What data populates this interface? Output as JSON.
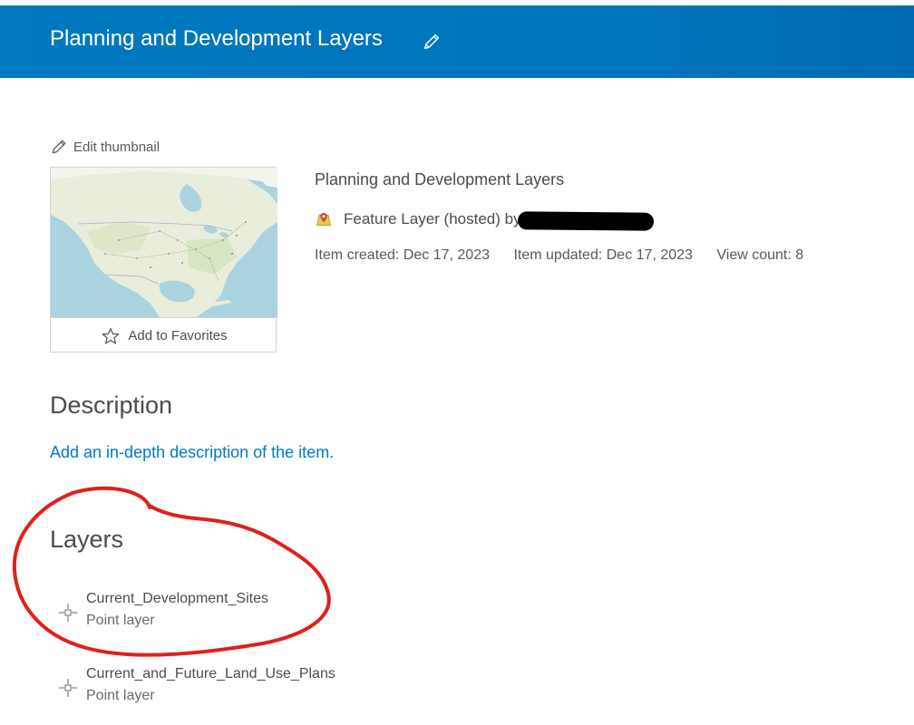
{
  "header": {
    "title": "Planning and Development Layers"
  },
  "thumbnail": {
    "edit_label": "Edit thumbnail",
    "favorites_label": "Add to Favorites"
  },
  "item": {
    "title": "Planning and Development Layers",
    "type_label": "Feature Layer (hosted) by",
    "created": "Item created: Dec 17, 2023",
    "updated": "Item updated: Dec 17, 2023",
    "views": "View count: 8"
  },
  "description": {
    "heading": "Description",
    "link": "Add an in-depth description of the item."
  },
  "layers": {
    "heading": "Layers",
    "items": [
      {
        "name": "Current_Development_Sites",
        "type": "Point layer"
      },
      {
        "name": "Current_and_Future_Land_Use_Plans",
        "type": "Point layer"
      }
    ]
  },
  "colors": {
    "header_blue": "#0079c1",
    "link_blue": "#0079c1",
    "annotation_red": "#e0201b"
  }
}
